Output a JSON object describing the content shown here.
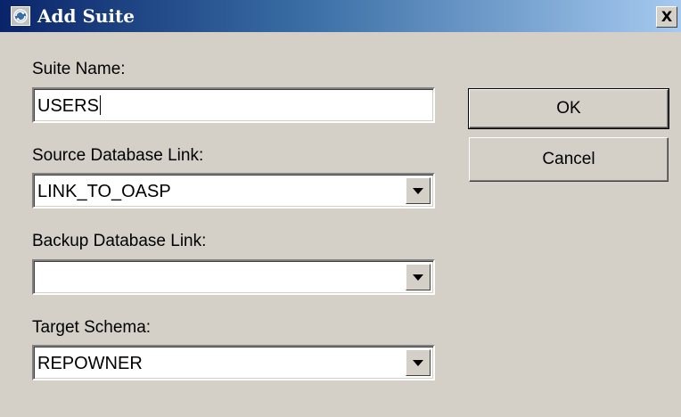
{
  "window": {
    "title": "Add Suite",
    "close_label": "X"
  },
  "form": {
    "suite_name": {
      "label": "Suite Name:",
      "value": "USERS"
    },
    "source_db_link": {
      "label": "Source Database Link:",
      "value": "LINK_TO_OASP"
    },
    "backup_db_link": {
      "label": "Backup Database Link:",
      "value": ""
    },
    "target_schema": {
      "label": "Target Schema:",
      "value": "REPOWNER"
    }
  },
  "buttons": {
    "ok_label": "OK",
    "cancel_label": "Cancel"
  },
  "icons": {
    "app": "app-icon",
    "close": "close-icon",
    "dropdown": "chevron-down-icon"
  },
  "colors": {
    "titlebar_start": "#0a246a",
    "titlebar_end": "#a6caf0",
    "dialog_bg": "#d4d0c8"
  }
}
